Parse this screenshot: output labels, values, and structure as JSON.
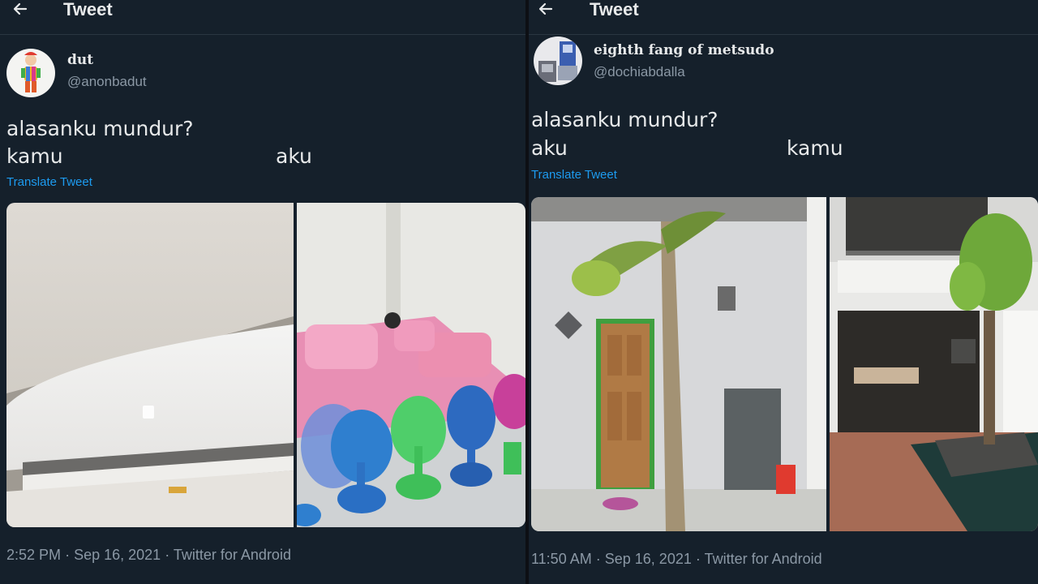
{
  "left": {
    "header": {
      "title": "Tweet",
      "back_icon": "arrow-left-icon"
    },
    "user": {
      "display_name": "dut",
      "handle": "@anonbadut"
    },
    "tweet": {
      "line1": "alasanku mundur?",
      "label_a": "kamu",
      "label_b": "aku"
    },
    "translate_label": "Translate Tweet",
    "footer": {
      "time": "2:52 PM",
      "date": "Sep 16, 2021",
      "source": "Twitter for Android"
    }
  },
  "right": {
    "header": {
      "title": "Tweet",
      "back_icon": "arrow-left-icon"
    },
    "user": {
      "display_name": "eighth fang of metsudo",
      "handle": "@dochiabdalla"
    },
    "tweet": {
      "line1": "alasanku mundur?",
      "label_a": "aku",
      "label_b": "kamu"
    },
    "translate_label": "Translate Tweet",
    "footer": {
      "time": "11:50 AM",
      "date": "Sep 16, 2021",
      "source": "Twitter for Android"
    }
  },
  "separator": "·",
  "colors": {
    "background": "#15202b",
    "text": "#e7e9ea",
    "muted": "#8b98a5",
    "link": "#1d9bf0"
  }
}
